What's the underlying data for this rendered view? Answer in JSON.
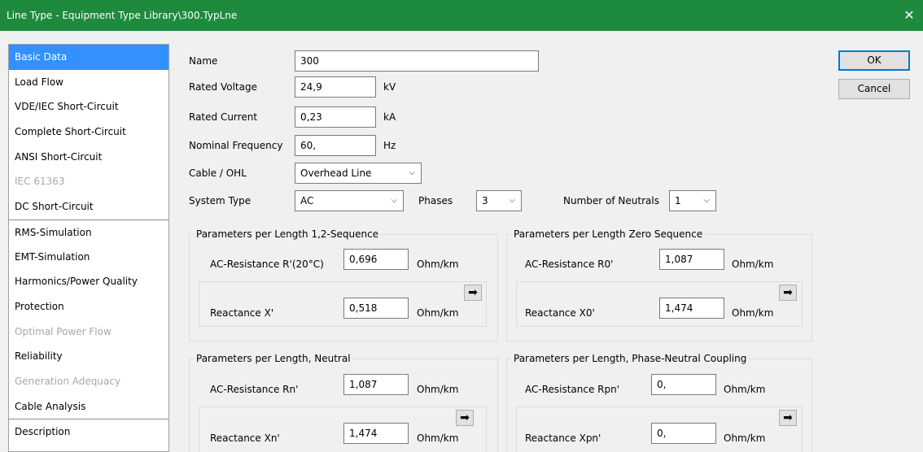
{
  "window": {
    "title": "Line Type - Equipment Type Library\\300.TypLne",
    "close_glyph": "✕"
  },
  "nav": {
    "items": [
      {
        "label": "Basic Data",
        "state": "selected"
      },
      {
        "label": "Load Flow",
        "state": "normal"
      },
      {
        "label": "VDE/IEC Short-Circuit",
        "state": "normal"
      },
      {
        "label": "Complete Short-Circuit",
        "state": "normal"
      },
      {
        "label": "ANSI Short-Circuit",
        "state": "normal"
      },
      {
        "label": "IEC 61363",
        "state": "disabled"
      },
      {
        "label": "DC Short-Circuit",
        "state": "normal"
      },
      {
        "label": "RMS-Simulation",
        "state": "normal"
      },
      {
        "label": "EMT-Simulation",
        "state": "normal"
      },
      {
        "label": "Harmonics/Power Quality",
        "state": "normal"
      },
      {
        "label": "Protection",
        "state": "normal"
      },
      {
        "label": "Optimal Power Flow",
        "state": "disabled"
      },
      {
        "label": "Reliability",
        "state": "normal"
      },
      {
        "label": "Generation Adequacy",
        "state": "disabled"
      },
      {
        "label": "Cable Analysis",
        "state": "normal"
      },
      {
        "label": "Description",
        "state": "normal"
      }
    ]
  },
  "basic": {
    "name_label": "Name",
    "name_value": "300",
    "voltage_label": "Rated Voltage",
    "voltage_value": "24,9",
    "voltage_unit": "kV",
    "current_label": "Rated Current",
    "current_value": "0,23",
    "current_unit": "kA",
    "frequency_label": "Nominal Frequency",
    "frequency_value": "60,",
    "frequency_unit": "Hz",
    "cable_label": "Cable / OHL",
    "cable_value": "Overhead Line",
    "system_label": "System Type",
    "system_value": "AC",
    "phases_label": "Phases",
    "phases_value": "3",
    "neutrals_label": "Number of Neutrals",
    "neutrals_value": "1"
  },
  "seq12": {
    "title": "Parameters per Length 1,2-Sequence",
    "r_label": "AC-Resistance R'(20°C)",
    "r_value": "0,696",
    "r_unit": "Ohm/km",
    "x_label": "Reactance X'",
    "x_value": "0,518",
    "x_unit": "Ohm/km"
  },
  "seq0": {
    "title": "Parameters per Length Zero Sequence",
    "r_label": "AC-Resistance R0'",
    "r_value": "1,087",
    "r_unit": "Ohm/km",
    "x_label": "Reactance X0'",
    "x_value": "1,474",
    "x_unit": "Ohm/km"
  },
  "neutral": {
    "title": "Parameters per Length, Neutral",
    "r_label": "AC-Resistance Rn'",
    "r_value": "1,087",
    "r_unit": "Ohm/km",
    "x_label": "Reactance Xn'",
    "x_value": "1,474",
    "x_unit": "Ohm/km"
  },
  "coupling": {
    "title": "Parameters per Length, Phase-Neutral Coupling",
    "r_label": "AC-Resistance Rpn'",
    "r_value": "0,",
    "r_unit": "Ohm/km",
    "x_label": "Reactance Xpn'",
    "x_value": "0,",
    "x_unit": "Ohm/km"
  },
  "buttons": {
    "ok": "OK",
    "cancel": "Cancel"
  },
  "icons": {
    "chevron": "⌵",
    "arrow": "➡"
  }
}
